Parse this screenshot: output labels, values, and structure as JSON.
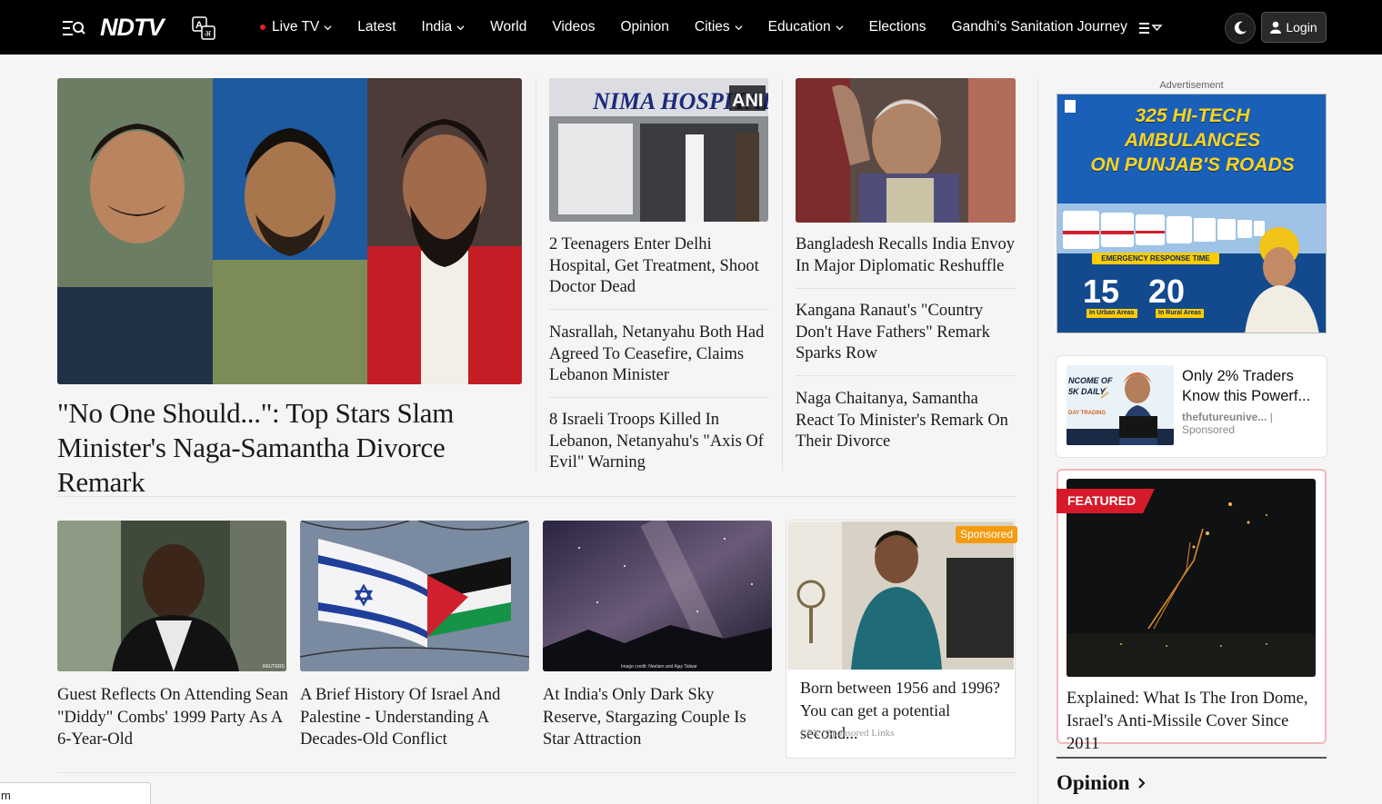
{
  "header": {
    "logo_text": "NDTV",
    "nav": [
      {
        "label": "Live TV",
        "dropdown": true,
        "live": true
      },
      {
        "label": "Latest",
        "dropdown": false
      },
      {
        "label": "India",
        "dropdown": true
      },
      {
        "label": "World",
        "dropdown": false
      },
      {
        "label": "Videos",
        "dropdown": false
      },
      {
        "label": "Opinion",
        "dropdown": false
      },
      {
        "label": "Cities",
        "dropdown": true
      },
      {
        "label": "Education",
        "dropdown": true
      },
      {
        "label": "Elections",
        "dropdown": false
      },
      {
        "label": "Gandhi's Sanitation Journey",
        "dropdown": false
      }
    ],
    "login_label": "Login",
    "icons": {
      "menu": "menu-search-icon",
      "language": "language-toggle-icon",
      "more": "more-menu-icon",
      "theme": "moon-icon",
      "user": "user-icon"
    }
  },
  "lead": {
    "title": "\"No One Should...\": Top Stars Slam Minister's Naga-Samantha Divorce Remark"
  },
  "middle": {
    "col1": {
      "image_badge": "ANI",
      "image_sign": "NIMA HOSPITAL",
      "stories": [
        "2 Teenagers Enter Delhi Hospital, Get Treatment, Shoot Doctor Dead",
        "Nasrallah, Netanyahu Both Had Agreed To Ceasefire, Claims Lebanon Minister",
        "8 Israeli Troops Killed In Lebanon, Netanyahu's \"Axis Of Evil\" Warning"
      ]
    },
    "col2": {
      "stories": [
        "Bangladesh Recalls India Envoy In Major Diplomatic Reshuffle",
        "Kangana Ranaut's \"Country Don't Have Fathers\" Remark Sparks Row",
        "Naga Chaitanya, Samantha React To Minister's Remark On Their Divorce"
      ]
    }
  },
  "bottom": {
    "stories": [
      "Guest Reflects On Attending Sean \"Diddy\" Combs' 1999 Party As A 6-Year-Old",
      "A Brief History Of Israel And Palestine - Understanding A Decades-Old Conflict",
      "At India's Only Dark Sky Reserve, Stargazing Couple Is Star Attraction"
    ],
    "image_credits": {
      "diddy": "REUTERS",
      "sky": "Image credit: Neelam and Ajay Talwar"
    },
    "ad_card": {
      "tag": "Sponsored",
      "title": "Born between 1956 and 1996? You can get a potential second...",
      "source": "CPX | Sponsored Links"
    }
  },
  "rail": {
    "ad_label": "Advertisement",
    "ad_banner": {
      "title_lines": [
        "325 HI-TECH",
        "AMBULANCES",
        "ON PUNJAB'S ROADS"
      ],
      "strip": "EMERGENCY RESPONSE TIME",
      "num1": "15",
      "num1_sub": "In Urban Areas",
      "num2": "20",
      "num2_sub": "In Rural Areas"
    },
    "sponsor": {
      "title": "Only 2% Traders Know this Powerf...",
      "source": "thefutureunive...",
      "tag": "| Sponsored",
      "img_text_1": "NCOME OF",
      "img_text_2": "5K DAILY",
      "img_text_3": "DAY TRADING"
    },
    "featured": {
      "badge": "FEATURED",
      "title": "Explained: What Is The Iron Dome, Israel's Anti-Missile Cover Since 2011"
    },
    "opinion_heading": "Opinion"
  },
  "status_text": "m",
  "colors": {
    "topbar": "#000000",
    "accent_red": "#d71a2a",
    "sponsor_orange": "#f39c12"
  }
}
